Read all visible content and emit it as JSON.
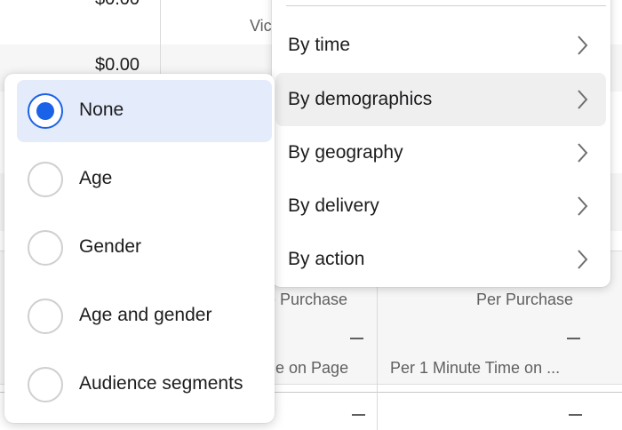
{
  "colors": {
    "accent": "#1a63e8",
    "selected_bg": "#e4ebfb",
    "hover_bg": "#efeff0"
  },
  "table": {
    "top_value": "$0.00",
    "row_value": "$0.00",
    "col_video_fragment": "Vic",
    "col1_header_fragment": "e Purchase",
    "col2_header": "Per Purchase",
    "col1_row2_fragment": "ne on Page",
    "col2_row2": "Per 1 Minute Time on ...",
    "empty_cell": "—"
  },
  "breakdown_menu": {
    "items": [
      {
        "label": "By time",
        "icon": "chevron-right-icon"
      },
      {
        "label": "By demographics",
        "icon": "chevron-right-icon",
        "active": true
      },
      {
        "label": "By geography",
        "icon": "chevron-right-icon"
      },
      {
        "label": "By delivery",
        "icon": "chevron-right-icon"
      },
      {
        "label": "By action",
        "icon": "chevron-right-icon"
      }
    ]
  },
  "demographics_submenu": {
    "options": [
      {
        "label": "None",
        "selected": true
      },
      {
        "label": "Age",
        "selected": false
      },
      {
        "label": "Gender",
        "selected": false
      },
      {
        "label": "Age and gender",
        "selected": false
      },
      {
        "label": "Audience segments",
        "selected": false
      }
    ]
  }
}
